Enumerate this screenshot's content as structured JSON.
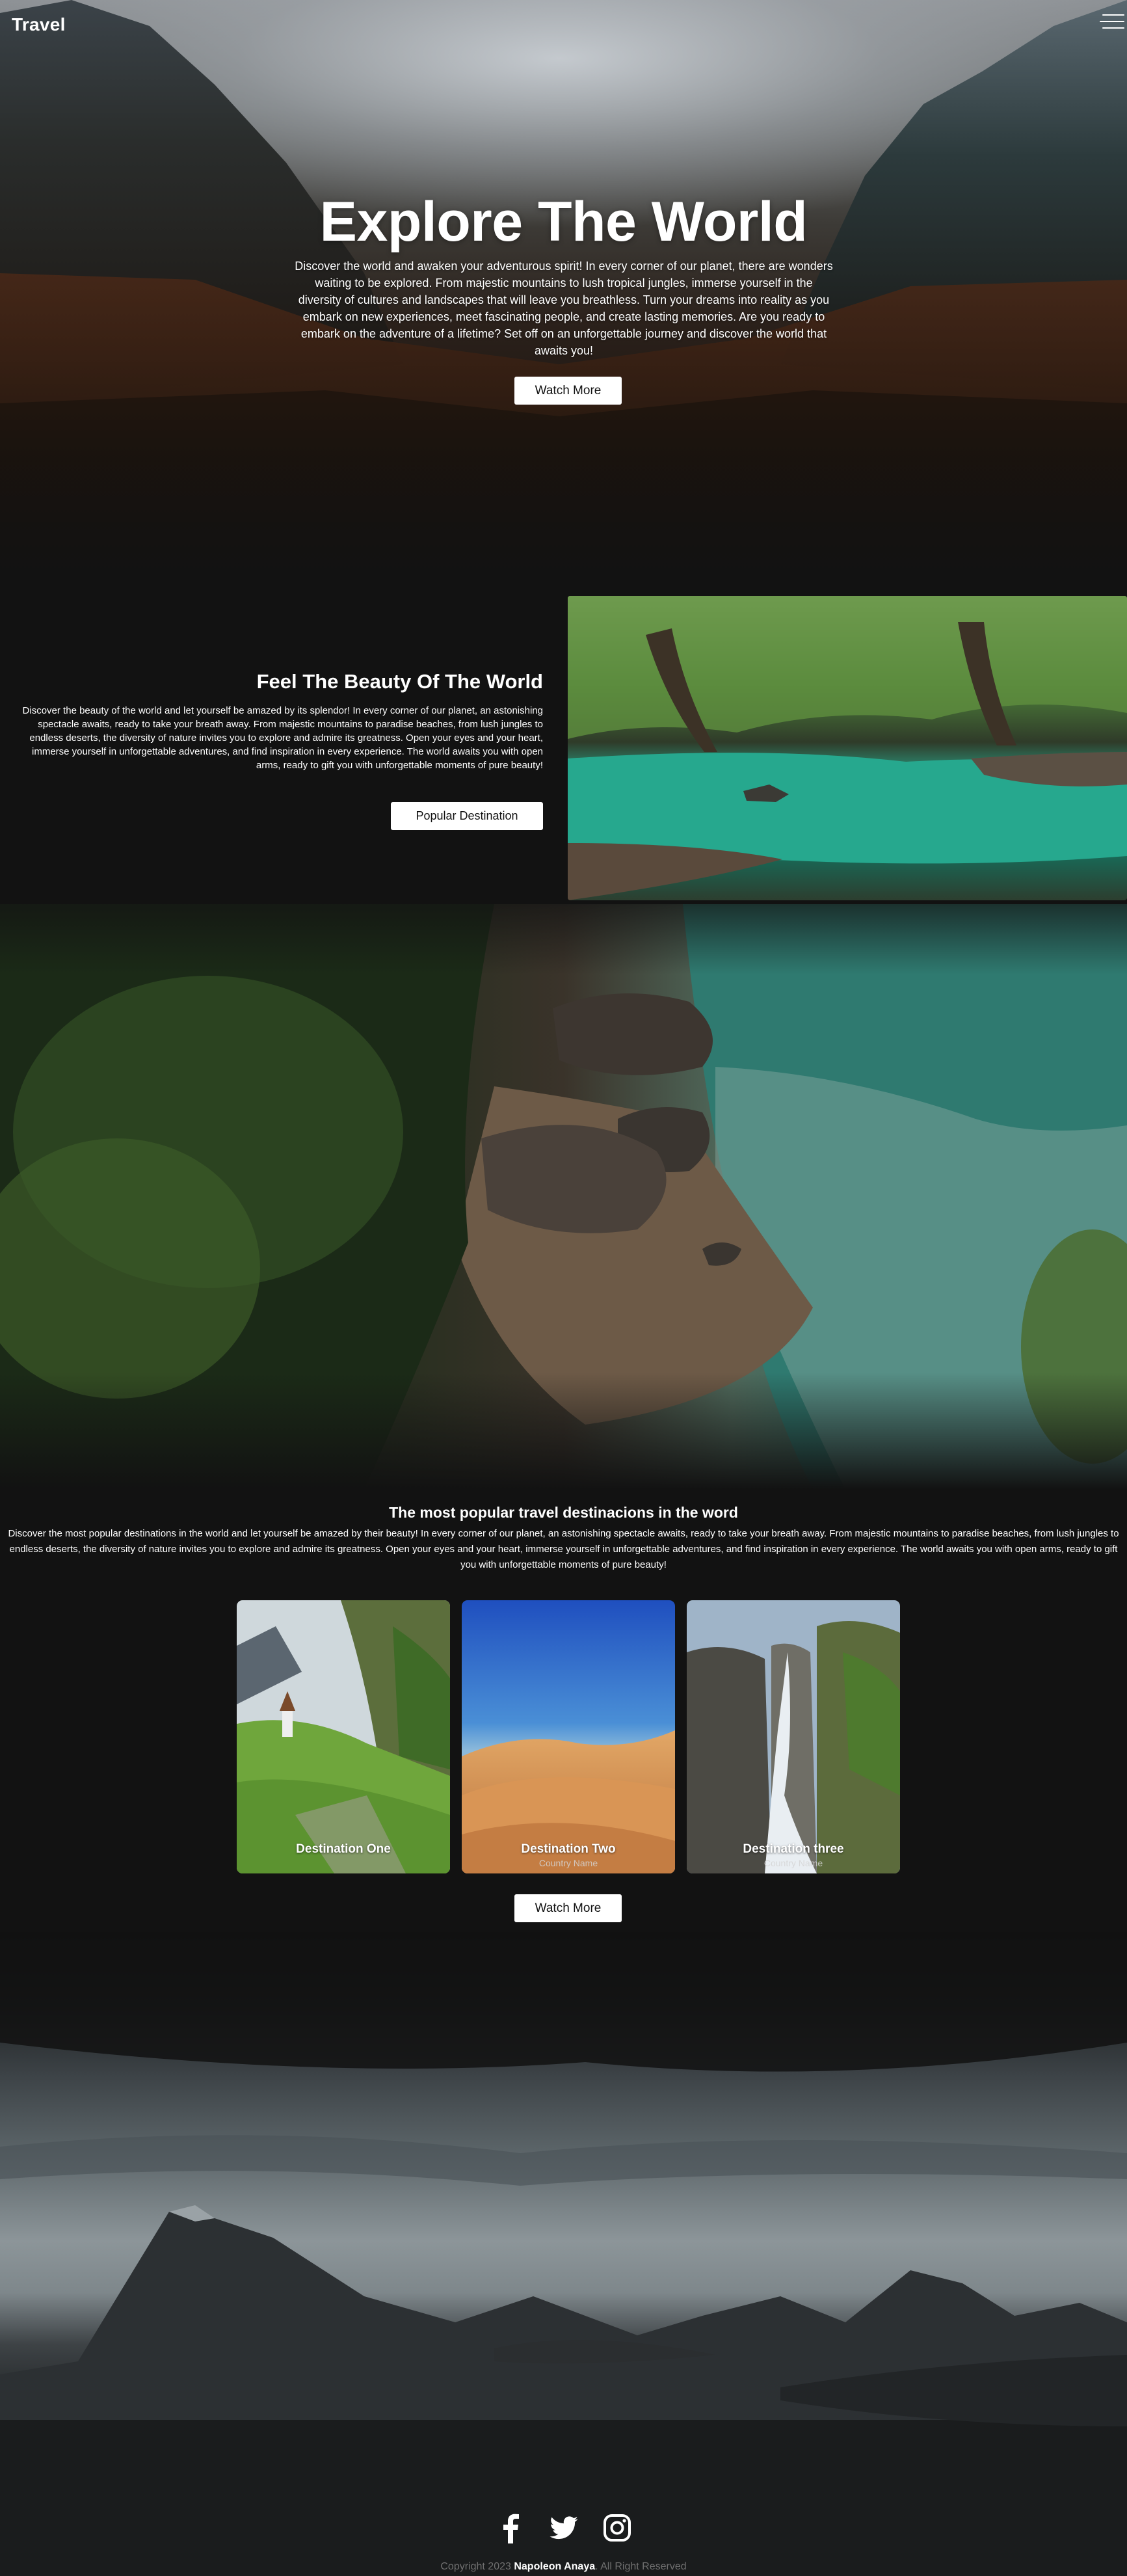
{
  "header": {
    "brand": "Travel",
    "menu_icon": "hamburger-icon"
  },
  "hero": {
    "title": "Explore The World",
    "text": "Discover the world and awaken your adventurous spirit! In every corner of our planet, there are wonders waiting to be explored. From majestic mountains to lush tropical jungles, immerse yourself in the diversity of cultures and landscapes that will leave you breathless. Turn your dreams into reality as you embark on new experiences, meet fascinating people, and create lasting memories. Are you ready to embark on the adventure of a lifetime? Set off on an unforgettable journey and discover the world that awaits you!",
    "button": "Watch More"
  },
  "feature": {
    "title": "Feel The Beauty Of The World",
    "text": "Discover the beauty of the world and let yourself be amazed by its splendor! In every corner of our planet, an astonishing spectacle awaits, ready to take your breath away. From majestic mountains to paradise beaches, from lush jungles to endless deserts, the diversity of nature invites you to explore and admire its greatness. Open your eyes and your heart, immerse yourself in unforgettable adventures, and find inspiration in every experience. The world awaits you with open arms, ready to gift you with unforgettable moments of pure beauty!",
    "button": "Popular Destination"
  },
  "popular": {
    "title": "The most popular travel destinacions in the word",
    "text": "Discover the most popular destinations in the world and let yourself be amazed by their beauty! In every corner of our planet, an astonishing spectacle awaits, ready to take your breath away. From majestic mountains to paradise beaches, from lush jungles to endless deserts, the diversity of nature invites you to explore and admire its greatness. Open your eyes and your heart, immerse yourself in unforgettable adventures, and find inspiration in every experience. The world awaits you with open arms, ready to gift you with unforgettable moments of pure beauty!",
    "cards": [
      {
        "name": "Destination One",
        "sub": "Country Name"
      },
      {
        "name": "Destination Two",
        "sub": "Country Name"
      },
      {
        "name": "Destination three",
        "sub": "Country Name"
      }
    ],
    "button": "Watch More"
  },
  "socials": [
    "facebook-icon",
    "twitter-icon",
    "instagram-icon"
  ],
  "footer": {
    "prefix": "Copyright 2023",
    "author": "Napoleon Anaya",
    "suffix": "All Right Reserved"
  },
  "colors": {
    "background": "#121212",
    "button_bg": "#ffffff",
    "button_text": "#111111",
    "footer_text": "#6f6f6f"
  }
}
